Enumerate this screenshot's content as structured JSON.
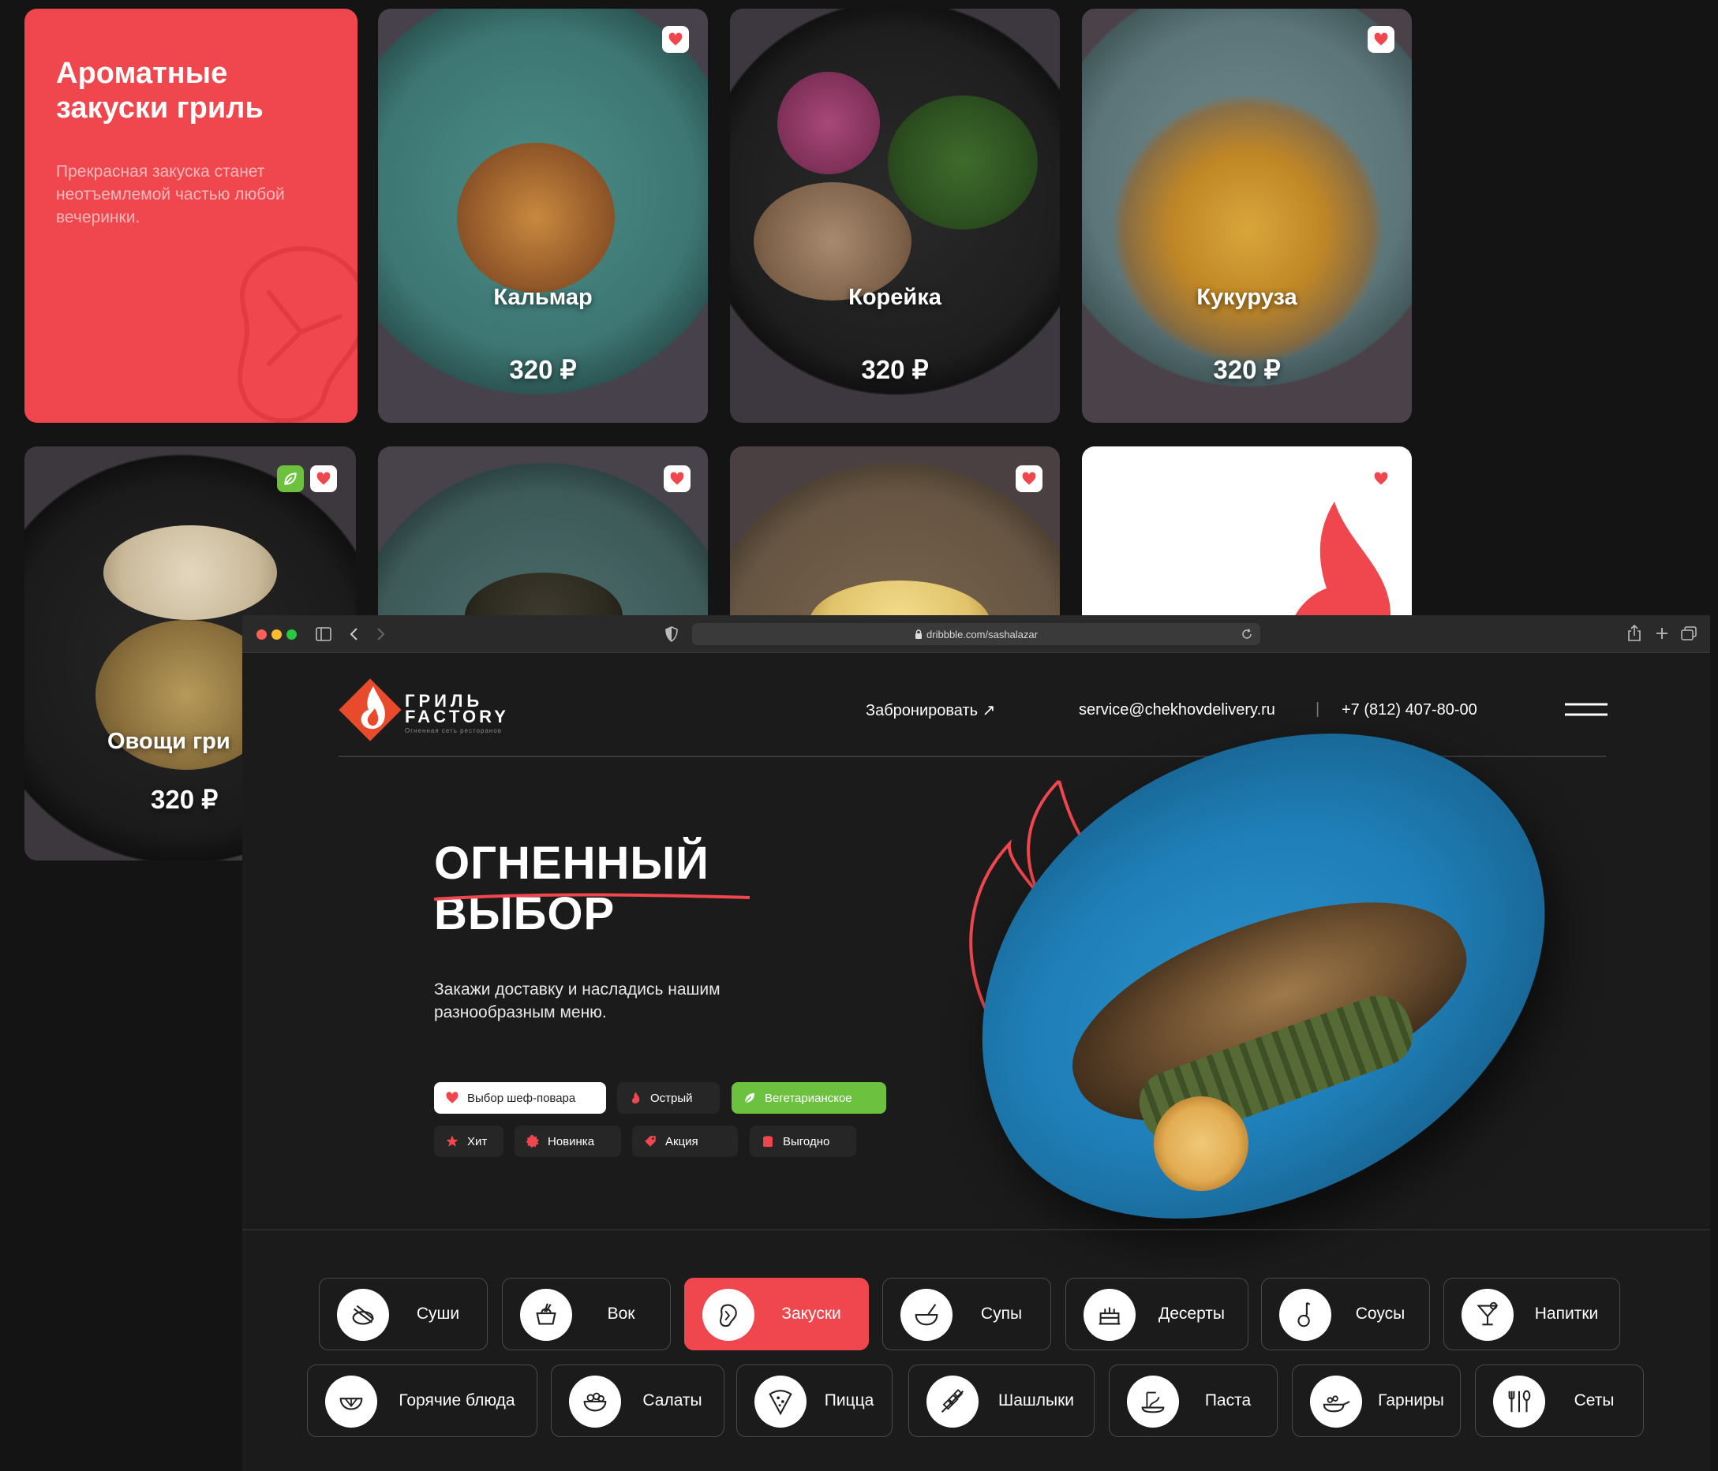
{
  "promo": {
    "title_line1": "Ароматные",
    "title_line2": "закуски гриль",
    "description": "Прекрасная закуска станет неотъемлемой частью любой вечеринки."
  },
  "dishes": [
    {
      "name": "Кальмар",
      "price": "320 ₽"
    },
    {
      "name": "Корейка",
      "price": "320 ₽"
    },
    {
      "name": "Кукуруза",
      "price": "320 ₽"
    },
    {
      "name": "Овощи гри",
      "price": "320 ₽"
    }
  ],
  "browser": {
    "url": "dribbble.com/sashalazar"
  },
  "header": {
    "logo_line1": "ГРИЛЬ",
    "logo_line2": "FACTORY",
    "logo_tagline": "Огненная сеть ресторанов",
    "book_label": "Забронировать ↗",
    "email": "service@chekhovdelivery.ru",
    "divider": "|",
    "phone": "+7 (812) 407-80-00"
  },
  "hero": {
    "title_line1": "ОГНЕННЫЙ",
    "title_line2": "ВЫБОР",
    "subtitle": "Закажи доставку и насладись нашим разнообразным меню."
  },
  "tags": [
    {
      "label": "Выбор шеф-повара",
      "icon": "heart-icon"
    },
    {
      "label": "Острый",
      "icon": "flame-icon"
    },
    {
      "label": "Вегетарианское",
      "icon": "leaf-icon"
    },
    {
      "label": "Хит",
      "icon": "star-icon"
    },
    {
      "label": "Новинка",
      "icon": "new-badge-icon"
    },
    {
      "label": "Акция",
      "icon": "sale-tag-icon"
    },
    {
      "label": "Выгодно",
      "icon": "coins-icon"
    }
  ],
  "categories_row1": [
    {
      "label": "Суши",
      "icon": "sushi-icon"
    },
    {
      "label": "Вок",
      "icon": "wok-icon"
    },
    {
      "label": "Закуски",
      "icon": "snack-icon",
      "active": true
    },
    {
      "label": "Супы",
      "icon": "soup-icon"
    },
    {
      "label": "Десерты",
      "icon": "cake-icon"
    },
    {
      "label": "Соусы",
      "icon": "sauce-icon"
    },
    {
      "label": "Напитки",
      "icon": "cocktail-icon"
    }
  ],
  "categories_row2": [
    {
      "label": "Горячие блюда",
      "icon": "hot-dish-icon"
    },
    {
      "label": "Салаты",
      "icon": "salad-icon"
    },
    {
      "label": "Пицца",
      "icon": "pizza-icon"
    },
    {
      "label": "Шашлыки",
      "icon": "skewer-icon"
    },
    {
      "label": "Паста",
      "icon": "pasta-icon"
    },
    {
      "label": "Гарниры",
      "icon": "side-dish-icon"
    },
    {
      "label": "Сеты",
      "icon": "cutlery-set-icon"
    }
  ],
  "colors": {
    "accent": "#f0464d",
    "green": "#6cc23f",
    "background": "#1b1b1b",
    "plate_blue": "#1f7fb8"
  }
}
